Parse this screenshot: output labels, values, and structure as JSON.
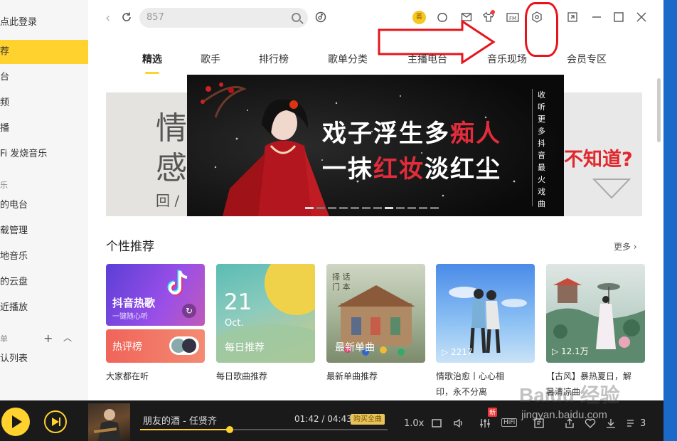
{
  "sidebar": {
    "login": "点此登录",
    "items": [
      {
        "label": "荐",
        "active": true
      },
      {
        "label": "台"
      },
      {
        "label": "频"
      },
      {
        "label": "播"
      },
      {
        "label": "Fi 发烧音乐"
      },
      {
        "label": "的电台"
      },
      {
        "label": "载管理"
      },
      {
        "label": "地音乐"
      },
      {
        "label": "的云盘"
      },
      {
        "label": "近播放"
      },
      {
        "label": "认列表"
      }
    ],
    "caption_music": "乐",
    "caption_playlist": "单",
    "add_label": "+",
    "collapse_label": "︿"
  },
  "topbar": {
    "search_value": "857",
    "vip_label": "荟",
    "icons": [
      "back-icon",
      "refresh-icon",
      "search-icon",
      "recognize-icon",
      "vip-icon",
      "skin-icon",
      "mail-icon",
      "clothes-icon",
      "fm-icon",
      "settings-icon",
      "mini-mode-icon",
      "minimize-icon",
      "maximize-icon",
      "close-icon"
    ]
  },
  "tabs": [
    "精选",
    "歌手",
    "排行榜",
    "歌单分类",
    "主播电台",
    "音乐现场",
    "会员专区"
  ],
  "banner": {
    "line1": "戏子浮生多",
    "line1_red": "痴人",
    "line2a": "一抹",
    "line2_red": "红妆",
    "line2b": "淡红尘",
    "vertical": "收听更多抖音最火戏曲",
    "left_peek_1": "情",
    "left_peek_2": "感",
    "left_peek_3": "回 /",
    "right_peek": "不知道?"
  },
  "section": {
    "title": "个性推荐",
    "more": "更多 ›"
  },
  "cards": [
    {
      "caption": "大家都在听",
      "top_label": "抖音热歌",
      "top_sub": "一键随心听",
      "bottom_label": "热评榜"
    },
    {
      "caption": "每日歌曲推荐",
      "day": "21",
      "month": "Oct.",
      "label": "每日推荐"
    },
    {
      "caption": "最新单曲推荐",
      "label": "最新单曲"
    },
    {
      "caption": "情歌治愈丨心心相印，永不分离",
      "plays": "▷ 2217"
    },
    {
      "caption": "【古风】暴热夏日，解暑清凉曲",
      "plays": "▷ 12.1万"
    }
  ],
  "player": {
    "song": "朋友的酒 - 任贤齐",
    "time": "01:42 / 04:43",
    "buy": "购买全曲",
    "speed": "1.0x",
    "new_badge": "新",
    "hifi": "HiFi",
    "count": "3",
    "progress": 0.361
  },
  "watermark": {
    "text": "Baidu 经验",
    "url_text": "jingyan.baidu.com"
  }
}
